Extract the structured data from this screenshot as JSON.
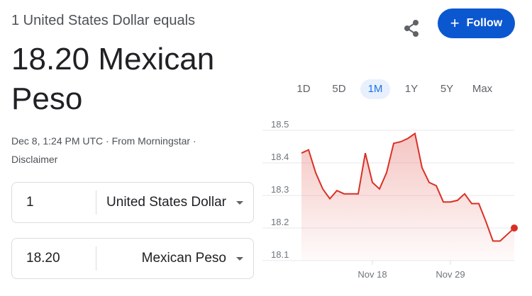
{
  "header": {
    "equals_text": "1 United States Dollar equals",
    "rate_text": "18.20 Mexican Peso"
  },
  "meta": {
    "timestamp": "Dec 8, 1:24 PM UTC",
    "separator": "·",
    "source": "From Morningstar",
    "disclaimer": "Disclaimer"
  },
  "actions": {
    "follow_label": "Follow",
    "follow_plus": "+"
  },
  "converter": {
    "from_amount": "1",
    "from_currency": "United States Dollar",
    "to_amount": "18.20",
    "to_currency": "Mexican Peso"
  },
  "ranges": [
    "1D",
    "5D",
    "1M",
    "1Y",
    "5Y",
    "Max"
  ],
  "selected_range": "1M",
  "chart_data": {
    "type": "area",
    "series": [
      {
        "values": [
          18.43,
          18.44,
          18.37,
          18.32,
          18.29,
          18.315,
          18.305,
          18.305,
          18.305,
          18.43,
          18.34,
          18.32,
          18.37,
          18.46,
          18.465,
          18.475,
          18.49,
          18.385,
          18.34,
          18.33,
          18.28,
          18.28,
          18.285,
          18.305,
          18.275,
          18.275,
          18.22,
          18.16,
          18.16,
          18.18,
          18.2
        ]
      }
    ],
    "ylim": [
      18.1,
      18.5
    ],
    "yticks": [
      "18.5",
      "18.4",
      "18.3",
      "18.2",
      "18.1"
    ],
    "xticks": [
      {
        "label": "Nov 18",
        "index": 10
      },
      {
        "label": "Nov 29",
        "index": 21
      }
    ],
    "grid": true,
    "line_color": "#d93025",
    "fill_color": "#fce8e6"
  }
}
